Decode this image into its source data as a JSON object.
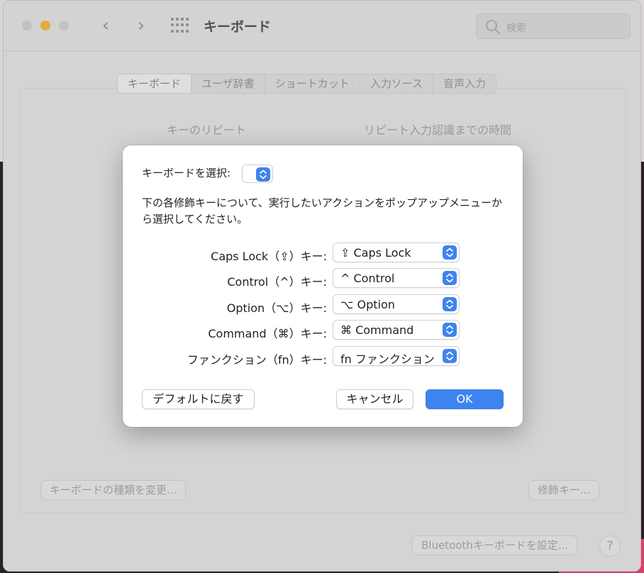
{
  "window": {
    "title": "キーボード",
    "search_placeholder": "検索"
  },
  "tabs": [
    {
      "label": "キーボード",
      "active": true
    },
    {
      "label": "ユーザ辞書",
      "active": false
    },
    {
      "label": "ショートカット",
      "active": false
    },
    {
      "label": "入力ソース",
      "active": false
    },
    {
      "label": "音声入力",
      "active": false
    }
  ],
  "panel": {
    "key_repeat_label": "キーのリピート",
    "delay_label": "リピート入力認識までの時間",
    "change_keyboard_type_button": "キーボードの種類を変更...",
    "modifier_keys_button": "修飾キー...",
    "bluetooth_button": "Bluetoothキーボードを設定...",
    "help_button": "?"
  },
  "dialog": {
    "select_keyboard_label": "キーボードを選択:",
    "description": "下の各修飾キーについて、実行したいアクションをポップアップメニューから選択してください。",
    "rows": [
      {
        "label": "Caps Lock（⇪）キー:",
        "value": "⇪ Caps Lock"
      },
      {
        "label": "Control（^）キー:",
        "value": "^ Control"
      },
      {
        "label": "Option（⌥）キー:",
        "value": "⌥ Option"
      },
      {
        "label": "Command（⌘）キー:",
        "value": "⌘ Command"
      },
      {
        "label": "ファンクション（fn）キー:",
        "value": "fn ファンクション"
      }
    ],
    "restore_defaults_button": "デフォルトに戻す",
    "cancel_button": "キャンセル",
    "ok_button": "OK"
  },
  "colors": {
    "accent": "#3d84ee",
    "minimize": "#f6bd44"
  }
}
